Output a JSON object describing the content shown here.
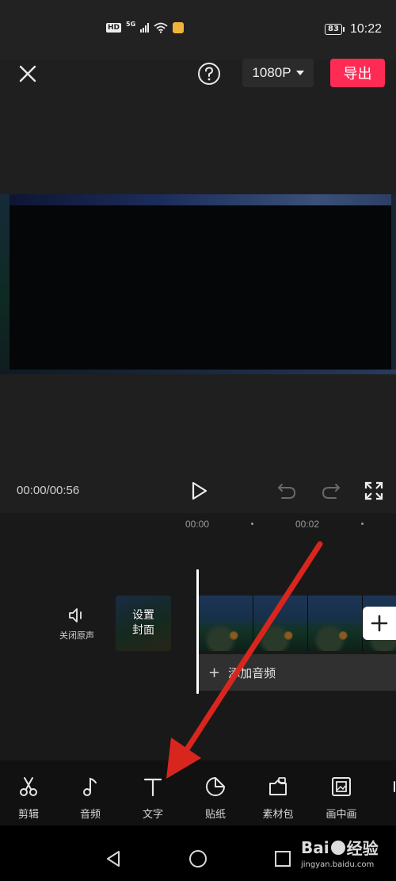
{
  "status_bar": {
    "hd": "HD",
    "network": "5G",
    "battery": "83",
    "time": "10:22"
  },
  "top_bar": {
    "resolution": "1080P",
    "export_label": "导出"
  },
  "playback": {
    "time": "00:00/00:56"
  },
  "timeline": {
    "ruler": [
      "00:00",
      "00:02"
    ],
    "mute_label": "关闭原声",
    "cover_line1": "设置",
    "cover_line2": "封面",
    "add_clip": "+",
    "add_audio_plus": "+",
    "add_audio_label": "添加音频"
  },
  "toolbar": {
    "items": [
      {
        "label": "剪辑",
        "icon": "scissors-icon"
      },
      {
        "label": "音频",
        "icon": "music-note-icon"
      },
      {
        "label": "文字",
        "icon": "text-icon"
      },
      {
        "label": "贴纸",
        "icon": "sticker-icon"
      },
      {
        "label": "素材包",
        "icon": "material-pack-icon"
      },
      {
        "label": "画中画",
        "icon": "picture-in-picture-icon"
      }
    ]
  },
  "annotation": {
    "color": "#d8261e"
  },
  "watermark": {
    "logo_left": "Bai",
    "logo_right": "经验",
    "url": "jingyan.baidu.com"
  }
}
